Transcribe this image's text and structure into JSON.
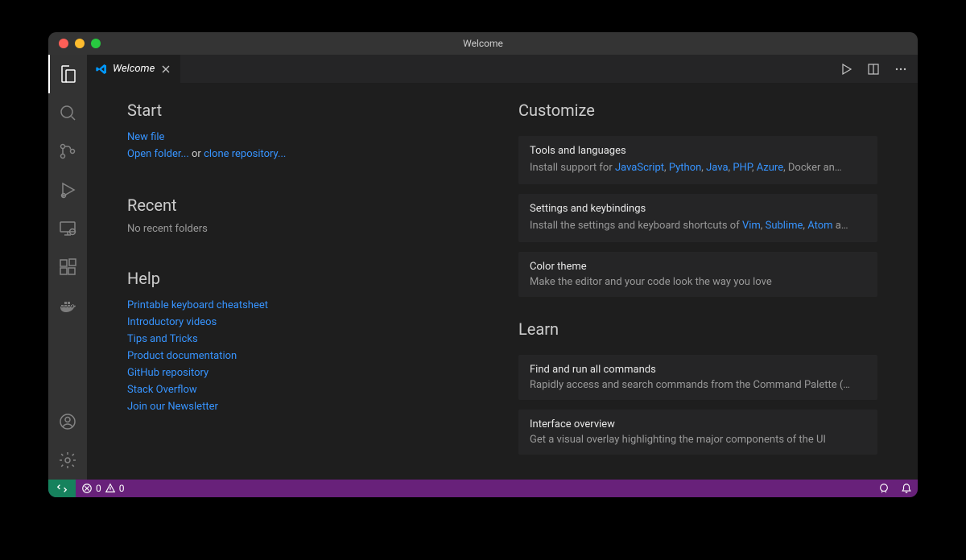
{
  "titlebar": {
    "title": "Welcome"
  },
  "tab": {
    "label": "Welcome"
  },
  "start": {
    "heading": "Start",
    "new_file": "New file",
    "open_folder": "Open folder...",
    "or": " or ",
    "clone_repo": "clone repository..."
  },
  "recent": {
    "heading": "Recent",
    "empty": "No recent folders"
  },
  "help": {
    "heading": "Help",
    "links": [
      "Printable keyboard cheatsheet",
      "Introductory videos",
      "Tips and Tricks",
      "Product documentation",
      "GitHub repository",
      "Stack Overflow",
      "Join our Newsletter"
    ]
  },
  "customize": {
    "heading": "Customize",
    "tools": {
      "title": "Tools and languages",
      "prefix": "Install support for ",
      "langs": [
        "JavaScript",
        "Python",
        "Java",
        "PHP",
        "Azure"
      ],
      "suffix": ", Docker an…"
    },
    "settings": {
      "title": "Settings and keybindings",
      "prefix": "Install the settings and keyboard shortcuts of ",
      "editors": [
        "Vim",
        "Sublime",
        "Atom"
      ],
      "suffix": " a…"
    },
    "theme": {
      "title": "Color theme",
      "desc": "Make the editor and your code look the way you love"
    }
  },
  "learn": {
    "heading": "Learn",
    "commands": {
      "title": "Find and run all commands",
      "desc": "Rapidly access and search commands from the Command Palette (…"
    },
    "overview": {
      "title": "Interface overview",
      "desc": "Get a visual overlay highlighting the major components of the UI"
    }
  },
  "statusbar": {
    "errors": "0",
    "warnings": "0"
  }
}
